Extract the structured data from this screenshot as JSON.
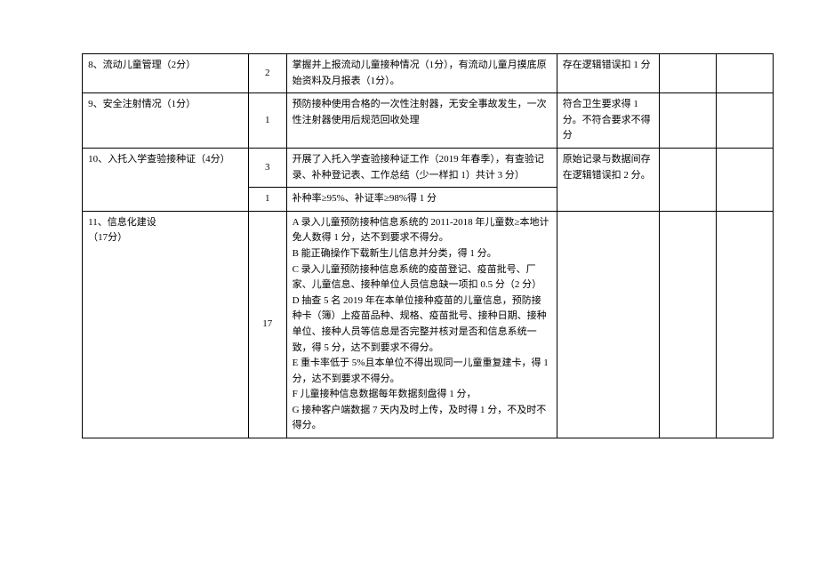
{
  "rows": [
    {
      "item": "8、流动儿童管理（2分）",
      "score": "2",
      "detail": "掌握并上报流动儿童接种情况（1分），有流动儿童月摸底原始资料及月报表（1分）。",
      "note": "存在逻辑错误扣 1 分"
    },
    {
      "item": "9、安全注射情况（1分）",
      "score": "1",
      "detail": "预防接种使用合格的一次性注射器，无安全事故发生，一次性注射器使用后规范回收处理",
      "note": "符合卫生要求得 1 分。不符合要求不得分"
    },
    {
      "item": "10、入托入学查验接种证（4分）",
      "score": "3",
      "detail": "开展了入托入学查验接种证工作（2019 年春季），有查验记录、补种登记表、工作总结（少一样扣 1）共计 3 分）",
      "note": "原始记录与数据间存在逻辑错误扣 2 分。"
    },
    {
      "item": "",
      "score": "1",
      "detail": "补种率≥95%、补证率≥98%得 1 分",
      "note": ""
    },
    {
      "item": "11、信息化建设\n（17分）",
      "score": "17",
      "detail": "A 录入儿童预防接种信息系统的 2011-2018 年儿童数≥本地计免人数得 1 分，达不到要求不得分。\nB 能正确操作下载新生儿信息并分类，得 1 分。\nC 录入儿童预防接种信息系统的疫苗登记、疫苗批号、厂家、儿童信息、接种单位人员信息缺一项扣 0.5 分（2 分）\nD 抽查 5 名 2019 年在本单位接种疫苗的儿童信息，预防接种卡（簿）上疫苗品种、规格、疫苗批号、接种日期、接种单位、接种人员等信息是否完整并核对是否和信息系统一致，得 5 分，达不到要求不得分。\nE 重卡率低于 5%且本单位不得出现同一儿童重复建卡，得 1 分，达不到要求不得分。\nF 儿童接种信息数据每年数据刻盘得 1 分，\nG 接种客户端数据 7 天内及时上传，及时得 1 分，不及时不得分。",
      "note": ""
    }
  ]
}
